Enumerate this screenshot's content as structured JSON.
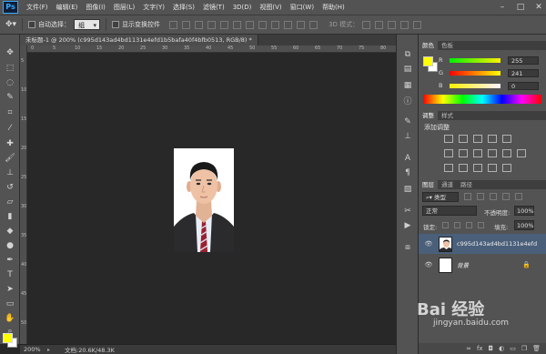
{
  "app": {
    "logo": "Ps"
  },
  "menu": [
    "文件(F)",
    "编辑(E)",
    "图像(I)",
    "图层(L)",
    "文字(Y)",
    "选择(S)",
    "滤镜(T)",
    "3D(D)",
    "视图(V)",
    "窗口(W)",
    "帮助(H)"
  ],
  "window_controls": [
    "–",
    "□",
    "✕"
  ],
  "options_bar": {
    "auto_select_label": "自动选择：",
    "auto_select_value": "组",
    "show_transform_label": "显示变换控件",
    "mode_3d_label": "3D 模式："
  },
  "document": {
    "tab_title": "未标题-1 @ 200% (c995d143ad4bd1131e4efd1b5bafa40f4bfb0513, RGB/8) *",
    "zoom": "200%",
    "doc_info": "文档:20.6K/48.3K"
  },
  "rulers": {
    "top_ticks": [
      "0",
      "5",
      "10",
      "15",
      "20",
      "25",
      "30",
      "35",
      "40",
      "45",
      "50",
      "55",
      "60",
      "65",
      "70",
      "75",
      "80"
    ],
    "left_ticks": [
      "5",
      "10",
      "15",
      "20",
      "25",
      "30",
      "35",
      "40",
      "45",
      "50"
    ]
  },
  "colors": {
    "foreground": "#ffff00",
    "background": "#ffffff"
  },
  "color_panel": {
    "tabs": [
      "颜色",
      "色板"
    ],
    "channels": [
      {
        "label": "R",
        "value": "255"
      },
      {
        "label": "G",
        "value": "241"
      },
      {
        "label": "B",
        "value": "0"
      }
    ]
  },
  "adjustments_panel": {
    "tabs": [
      "调整",
      "样式"
    ],
    "title": "添加调整"
  },
  "layers_panel": {
    "tabs": [
      "图层",
      "通道",
      "路径"
    ],
    "filter_kind": "类型",
    "blend_mode": "正常",
    "opacity_label": "不透明度:",
    "opacity_value": "100%",
    "lock_label": "锁定:",
    "fill_label": "填充:",
    "fill_value": "100%",
    "layers": [
      {
        "name": "c995d143ad4bd1131e4efd...",
        "selected": true
      },
      {
        "name": "背景",
        "locked": true,
        "selected": false
      }
    ]
  },
  "watermark": {
    "brand": "Bai 经验",
    "url": "jingyan.baidu.com"
  }
}
